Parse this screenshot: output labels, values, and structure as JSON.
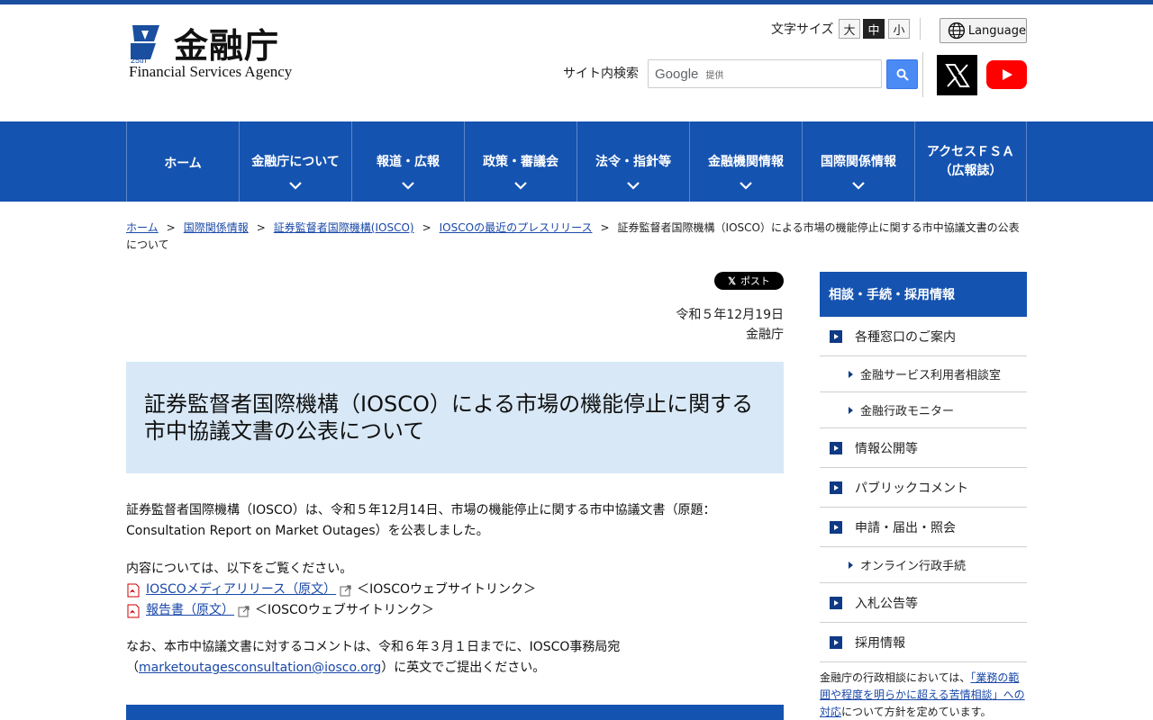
{
  "header": {
    "logo_jp": "金融庁",
    "logo_en": "Financial Services Agency",
    "font_size_label": "文字サイズ",
    "font_sizes": [
      "大",
      "中",
      "小"
    ],
    "language_label": "Language",
    "search_label": "サイト内検索",
    "search_google": "Google",
    "search_provided": "提供"
  },
  "nav": {
    "items": [
      "ホーム",
      "金融庁について",
      "報道・広報",
      "政策・審議会",
      "法令・指針等",
      "金融機関情報",
      "国際関係情報"
    ],
    "last_line1": "アクセスＦＳＡ",
    "last_line2": "（広報誌）"
  },
  "breadcrumb": {
    "links": [
      "ホーム",
      "国際関係情報",
      "証券監督者国際機構(IOSCO)",
      "IOSCOの最近のプレスリリース"
    ],
    "current": "証券監督者国際機構（IOSCO）による市場の機能停止に関する市中協議文書の公表について",
    "separator": ">"
  },
  "article": {
    "post_label": "ポスト",
    "date": "令和５年12月19日",
    "org": "金融庁",
    "title": "証券監督者国際機構（IOSCO）による市場の機能停止に関する市中協議文書の公表について",
    "para1": "証券監督者国際機構（IOSCO）は、令和５年12月14日、市場の機能停止に関する市中協議文書（原題：Consultation Report  on Market Outages）を公表しました。",
    "para2_intro": "内容については、以下をご覧ください。",
    "link1": "IOSCOメディアリリース（原文）",
    "link1_suffix": "＜IOSCOウェブサイトリンク＞",
    "link2": "報告書（原文）",
    "link2_suffix": "＜IOSCOウェブサイトリンク＞",
    "para3_a": "なお、本市中協議文書に対するコメントは、令和６年３月１日までに、IOSCO事務局宛",
    "para3_open": "（",
    "para3_email": "marketoutagesconsultation@iosco.org",
    "para3_b": "）に英文でご提出ください。"
  },
  "sidebar": {
    "heading": "相談・手続・採用情報",
    "item_1": "各種窓口のご案内",
    "sub_1a": "金融サービス利用者相談室",
    "sub_1b": "金融行政モニター",
    "item_2": "情報公開等",
    "item_3": "パブリックコメント",
    "item_4": "申請・届出・照会",
    "sub_4a": "オンライン行政手続",
    "item_5": "入札公告等",
    "item_6": "採用情報",
    "note_a": "金融庁の行政相談においては、",
    "note_link": "「業務の範囲や程度を明らかに超える苦情相談」への対応",
    "note_b": "について方針を定めています。"
  },
  "colors": {
    "brand_blue": "#1553b0",
    "title_bg": "#d8e8f6",
    "link": "#1a48a8"
  }
}
